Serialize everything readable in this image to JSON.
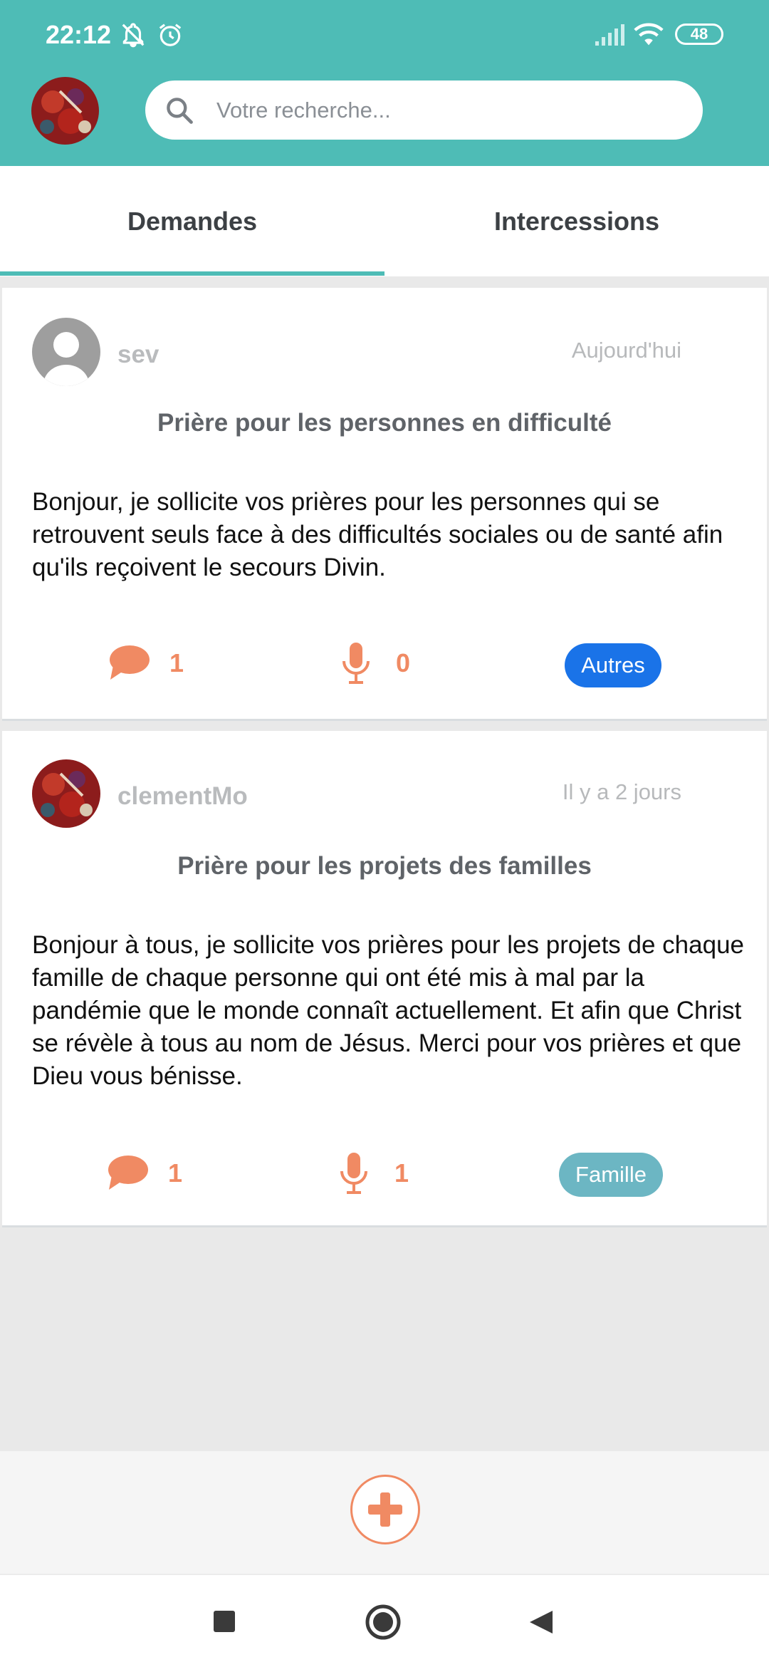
{
  "status_bar": {
    "time": "22:12",
    "battery": "48",
    "icons": [
      "notifications-off-icon",
      "alarm-icon",
      "signal-icon",
      "wifi-icon",
      "battery-icon"
    ]
  },
  "header": {
    "search_placeholder": "Votre recherche...",
    "accent_color": "#4ebcb6"
  },
  "tabs": [
    {
      "label": "Demandes",
      "active": true
    },
    {
      "label": "Intercessions",
      "active": false
    }
  ],
  "posts": [
    {
      "user": "sev",
      "date": "Aujourd'hui",
      "title": "Prière pour les personnes en difficulté",
      "body": "Bonjour, je sollicite vos prières pour les personnes qui se retrouvent seuls face à des difficultés sociales ou de santé afin qu'ils reçoivent le secours Divin.",
      "comments": "1",
      "voice": "0",
      "tag": "Autres",
      "tag_color": "#1a73e8"
    },
    {
      "user": "clementMo",
      "date": "Il y a 2 jours",
      "title": "Prière pour les projets des familles",
      "body": " Bonjour à tous, je sollicite vos prières pour les projets de chaque famille de chaque personne qui ont été mis à mal par la pandémie que le monde connaît actuellement. Et afin que Christ se révèle à tous au nom de Jésus. Merci pour vos prières et que Dieu vous bénisse.",
      "comments": "1",
      "voice": "1",
      "tag": "Famille",
      "tag_color": "#6cb6c3"
    }
  ],
  "colors": {
    "icon_orange": "#f08a63"
  }
}
